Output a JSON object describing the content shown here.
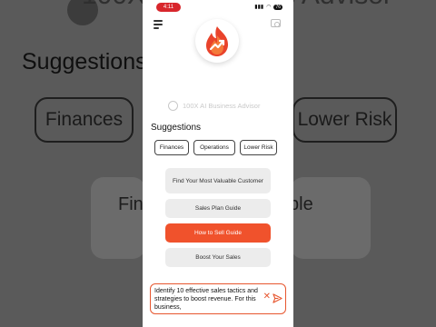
{
  "app": {
    "title": "100X AI Business Advisor"
  },
  "status_bar": {
    "time": "4:11",
    "battery": "76"
  },
  "background": {
    "title": "100X AI Business Advisor",
    "suggestions_heading": "Suggestions",
    "chips": [
      "Finances",
      "Lower Risk"
    ],
    "card_left": "Fin",
    "card_right": "ble"
  },
  "suggestions": {
    "heading": "Suggestions",
    "chips": [
      "Finances",
      "Operations",
      "Lower Risk"
    ]
  },
  "cards": [
    "Find Your Most Valuable Customer",
    "Sales Plan Guide",
    "How to Sell Guide",
    "Boost Your Sales"
  ],
  "colors": {
    "accent": "#f0522c",
    "status_pill": "#d8262c"
  },
  "input": {
    "value": "Identify 10 effective sales tactics and strategies to boost revenue. For this business,"
  },
  "icons": {
    "menu": "hamburger-icon",
    "camera": "camera-icon",
    "logo": "fire-icon",
    "clear": "close-icon",
    "send": "send-icon"
  }
}
